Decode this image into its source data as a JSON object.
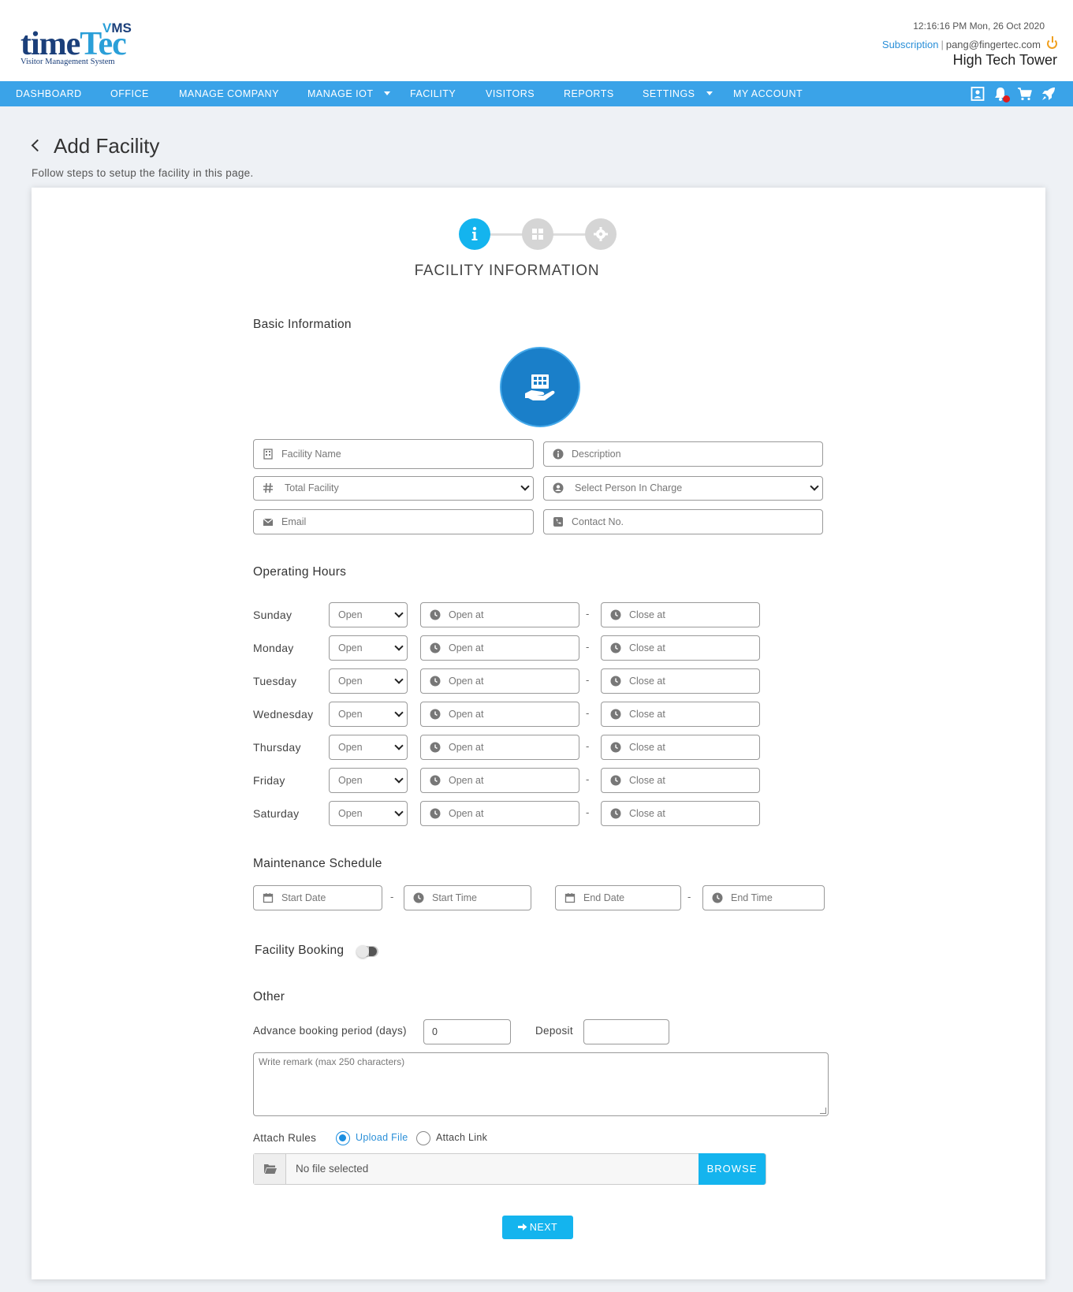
{
  "brand": {
    "logo_main_a": "time",
    "logo_main_b": "Tec",
    "logo_vms_v": "V",
    "logo_vms_rest": "MS",
    "logo_subtitle": "Visitor Management System"
  },
  "header": {
    "datetime": "12:16:16 PM  Mon, 26 Oct 2020",
    "subscription": "Subscription",
    "separator": "|",
    "email": "pang@fingertec.com",
    "building": "High Tech Tower"
  },
  "nav": {
    "items": [
      "DASHBOARD",
      "OFFICE",
      "MANAGE COMPANY",
      "MANAGE IOT",
      "FACILITY",
      "VISITORS",
      "REPORTS",
      "SETTINGS",
      "MY ACCOUNT"
    ],
    "icons": [
      "profile-icon",
      "notification-bell-icon",
      "cart-icon",
      "rocket-icon"
    ]
  },
  "page": {
    "title": "Add Facility",
    "subtitle": "Follow steps to setup the facility in this page.",
    "step_title": "FACILITY INFORMATION",
    "step_icons": [
      "info-icon",
      "grid-icon",
      "gear-icon"
    ]
  },
  "basic": {
    "title": "Basic Information",
    "facility_name": "Facility Name",
    "description": "Description",
    "total_facility": "Total Facility",
    "person_in_charge": "Select Person In Charge",
    "email": "Email",
    "contact": "Contact No."
  },
  "hours": {
    "title": "Operating Hours",
    "status_value": "Open",
    "open_placeholder": "Open at",
    "close_placeholder": "Close at",
    "separator": "-",
    "days": [
      "Sunday",
      "Monday",
      "Tuesday",
      "Wednesday",
      "Thursday",
      "Friday",
      "Saturday"
    ]
  },
  "maintenance": {
    "title": "Maintenance Schedule",
    "start_date": "Start Date",
    "start_time": "Start Time",
    "end_date": "End Date",
    "end_time": "End Time",
    "separator": "-"
  },
  "booking": {
    "label": "Facility Booking",
    "enabled": false
  },
  "other": {
    "title": "Other",
    "advance_label": "Advance booking period (days)",
    "advance_value": "0",
    "deposit_label": "Deposit",
    "deposit_value": "",
    "remark_placeholder": "Write remark (max 250 characters)",
    "attach_label": "Attach Rules",
    "upload_option": "Upload File",
    "link_option": "Attach Link",
    "file_text": "No file selected",
    "browse": "BROWSE"
  },
  "actions": {
    "next": "NEXT"
  },
  "colors": {
    "nav": "#3aa3e8",
    "accent": "#14b4ee",
    "step_active": "#14b4ee",
    "step_inactive": "#d5d5d5"
  }
}
